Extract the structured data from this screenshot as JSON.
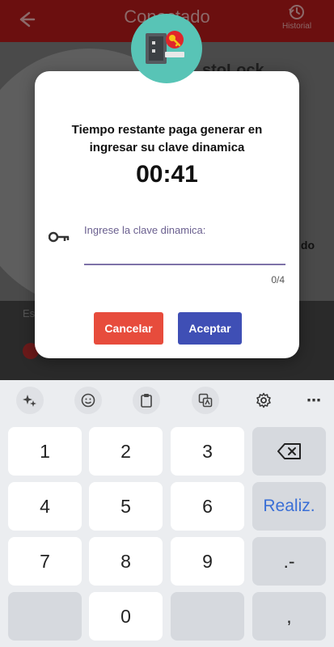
{
  "appbar": {
    "title": "Conectado",
    "history_label": "Historial"
  },
  "background": {
    "brand_text": "stoLock",
    "right_text": "do",
    "label_text": "Es"
  },
  "dialog": {
    "message": "Tiempo restante paga generar en ingresar su clave dinamica",
    "timer": "00:41",
    "field_label": "Ingrese la clave dinamica:",
    "field_value": "",
    "counter": "0/4",
    "cancel_label": "Cancelar",
    "accept_label": "Aceptar"
  },
  "keyboard": {
    "keys": {
      "k1": "1",
      "k2": "2",
      "k3": "3",
      "k4": "4",
      "k5": "5",
      "k6": "6",
      "k7": "7",
      "k8": "8",
      "k9": "9",
      "k0": "0",
      "done": "Realiz.",
      "dot_dash": ".-",
      "comma": ","
    },
    "toolbar_icons": [
      "sparkle-icon",
      "emoji-icon",
      "clipboard-icon",
      "translate-icon",
      "gear-icon",
      "more-icon"
    ]
  },
  "colors": {
    "appbar": "#6b0f0f",
    "badge": "#58c4b6",
    "cancel": "#e74c3c",
    "accept": "#3f4fb5",
    "done_key": "#3a6fd6"
  }
}
